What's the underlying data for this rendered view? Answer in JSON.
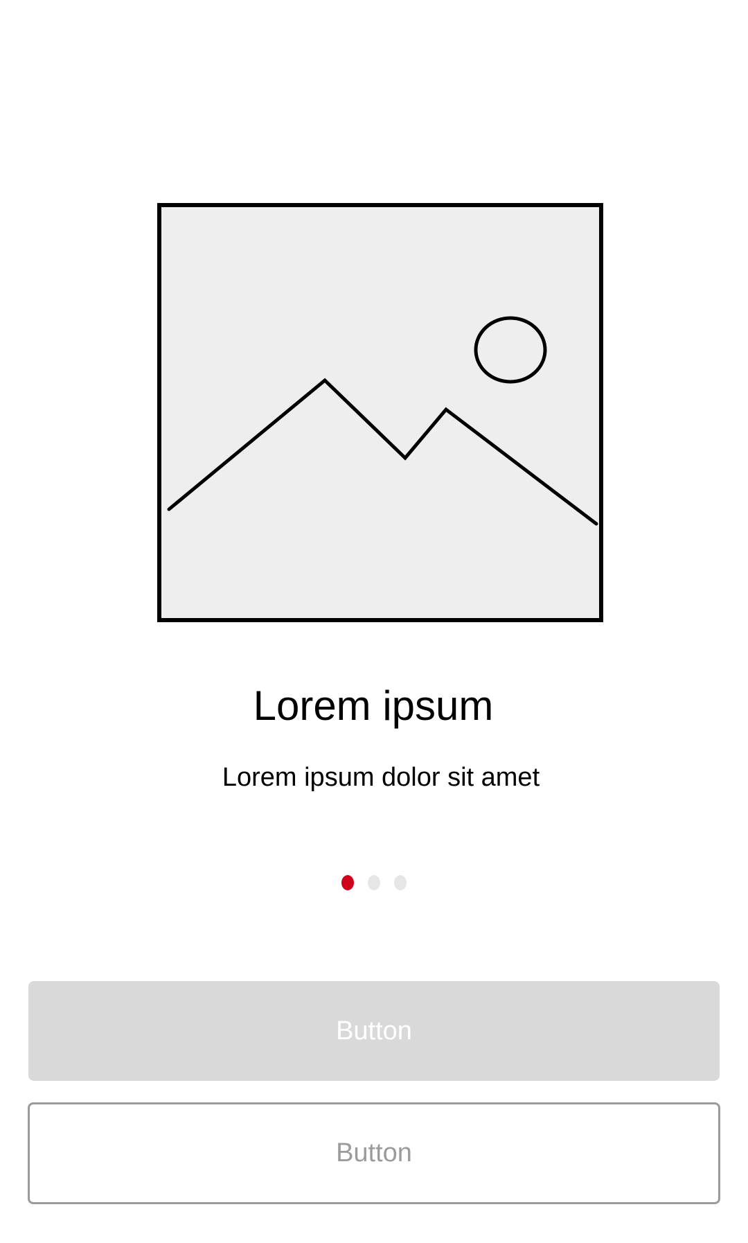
{
  "onboarding": {
    "image": {
      "icon": "image-placeholder-icon",
      "background_color": "#eeeeee",
      "border_color": "#000000"
    },
    "title": "Lorem ipsum",
    "subtitle": "Lorem ipsum dolor sit amet",
    "pager": {
      "page_count": 3,
      "current_page": 1,
      "active_color": "#d0021b",
      "inactive_color": "#e6e6e6"
    },
    "primary_button": {
      "label": "Button",
      "background_color": "#d9d9d9"
    },
    "secondary_button": {
      "label": "Button",
      "border_color": "#9b9b9b"
    }
  }
}
